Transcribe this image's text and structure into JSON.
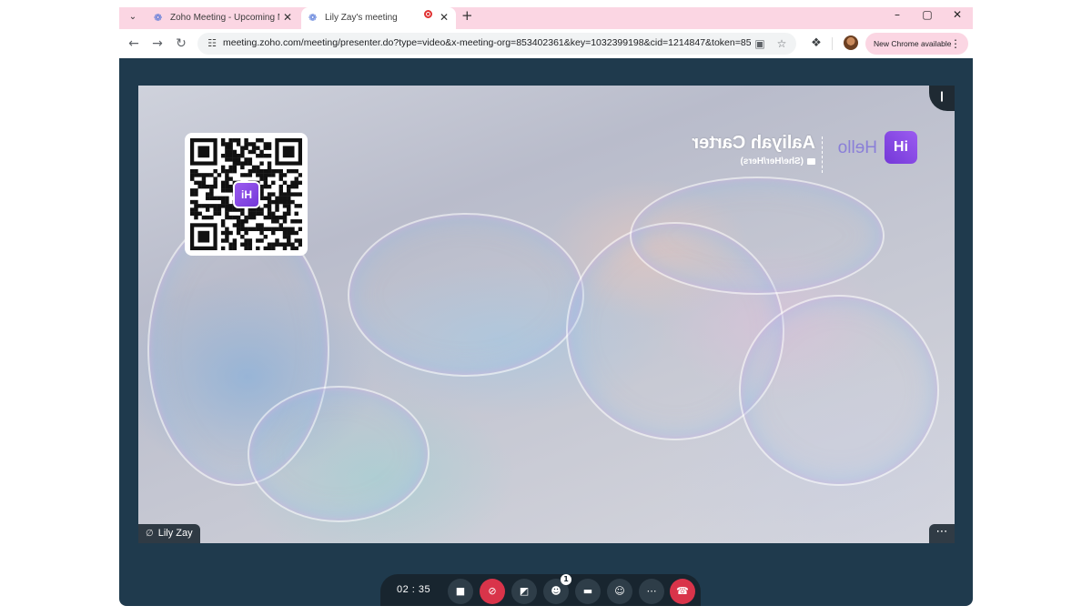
{
  "browser": {
    "tabs": [
      {
        "title": "Zoho Meeting - Upcoming Meetings",
        "active": false,
        "favicon": "zoho-icon"
      },
      {
        "title": "Lily Zay's meeting",
        "active": true,
        "favicon": "zoho-icon",
        "recording": true
      }
    ],
    "url": "meeting.zoho.com/meeting/presenter.do?type=video&x-meeting-org=853402361&key=1032399198&cid=1214847&token=85...",
    "update_pill": "New Chrome available",
    "colors": {
      "tabstrip": "#fbd6e3",
      "window": "#1f3a4d"
    }
  },
  "stage": {
    "presenter_name": "Lily Zay",
    "overlay": {
      "greeting": "Hello",
      "display_name": "Aaliyah Carter",
      "pronouns": "(She/Her/Hers)",
      "logo_text": "iH"
    },
    "qr_logo_text": "iH"
  },
  "controls": {
    "timer": "02 : 35",
    "participants_count": "1",
    "end_color": "#d9344a"
  }
}
